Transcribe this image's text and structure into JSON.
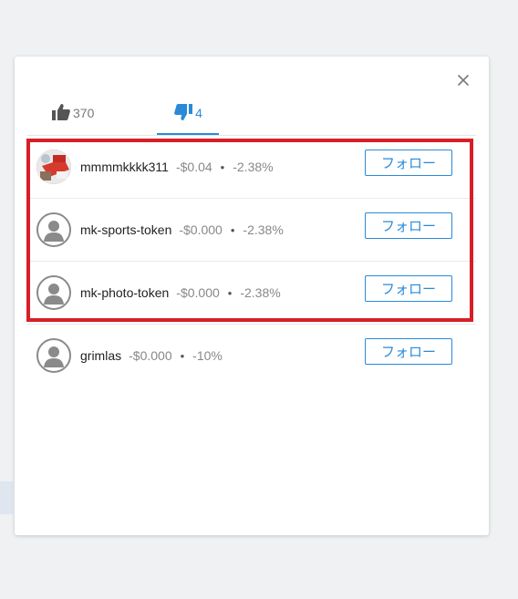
{
  "modal": {
    "close_icon": "close-icon",
    "tabs": [
      {
        "name": "like",
        "icon": "thumbs-up-icon",
        "count": "370",
        "active": false
      },
      {
        "name": "dislike",
        "icon": "thumbs-down-icon",
        "count": "4",
        "active": true
      }
    ],
    "voters": [
      {
        "username": "mmmmkkkk311",
        "amount": "-$0.04",
        "separator": "•",
        "percent": "-2.38%",
        "follow_label": "フォロー",
        "avatar": "photo"
      },
      {
        "username": "mk-sports-token",
        "amount": "-$0.000",
        "separator": "•",
        "percent": "-2.38%",
        "follow_label": "フォロー",
        "avatar": "default"
      },
      {
        "username": "mk-photo-token",
        "amount": "-$0.000",
        "separator": "•",
        "percent": "-2.38%",
        "follow_label": "フォロー",
        "avatar": "default"
      },
      {
        "username": "grimlas",
        "amount": "-$0.000",
        "separator": "•",
        "percent": "-10%",
        "follow_label": "フォロー",
        "avatar": "default"
      }
    ]
  },
  "colors": {
    "accent": "#2a8ad8",
    "highlight": "#d61f26",
    "muted_text": "#888888"
  }
}
